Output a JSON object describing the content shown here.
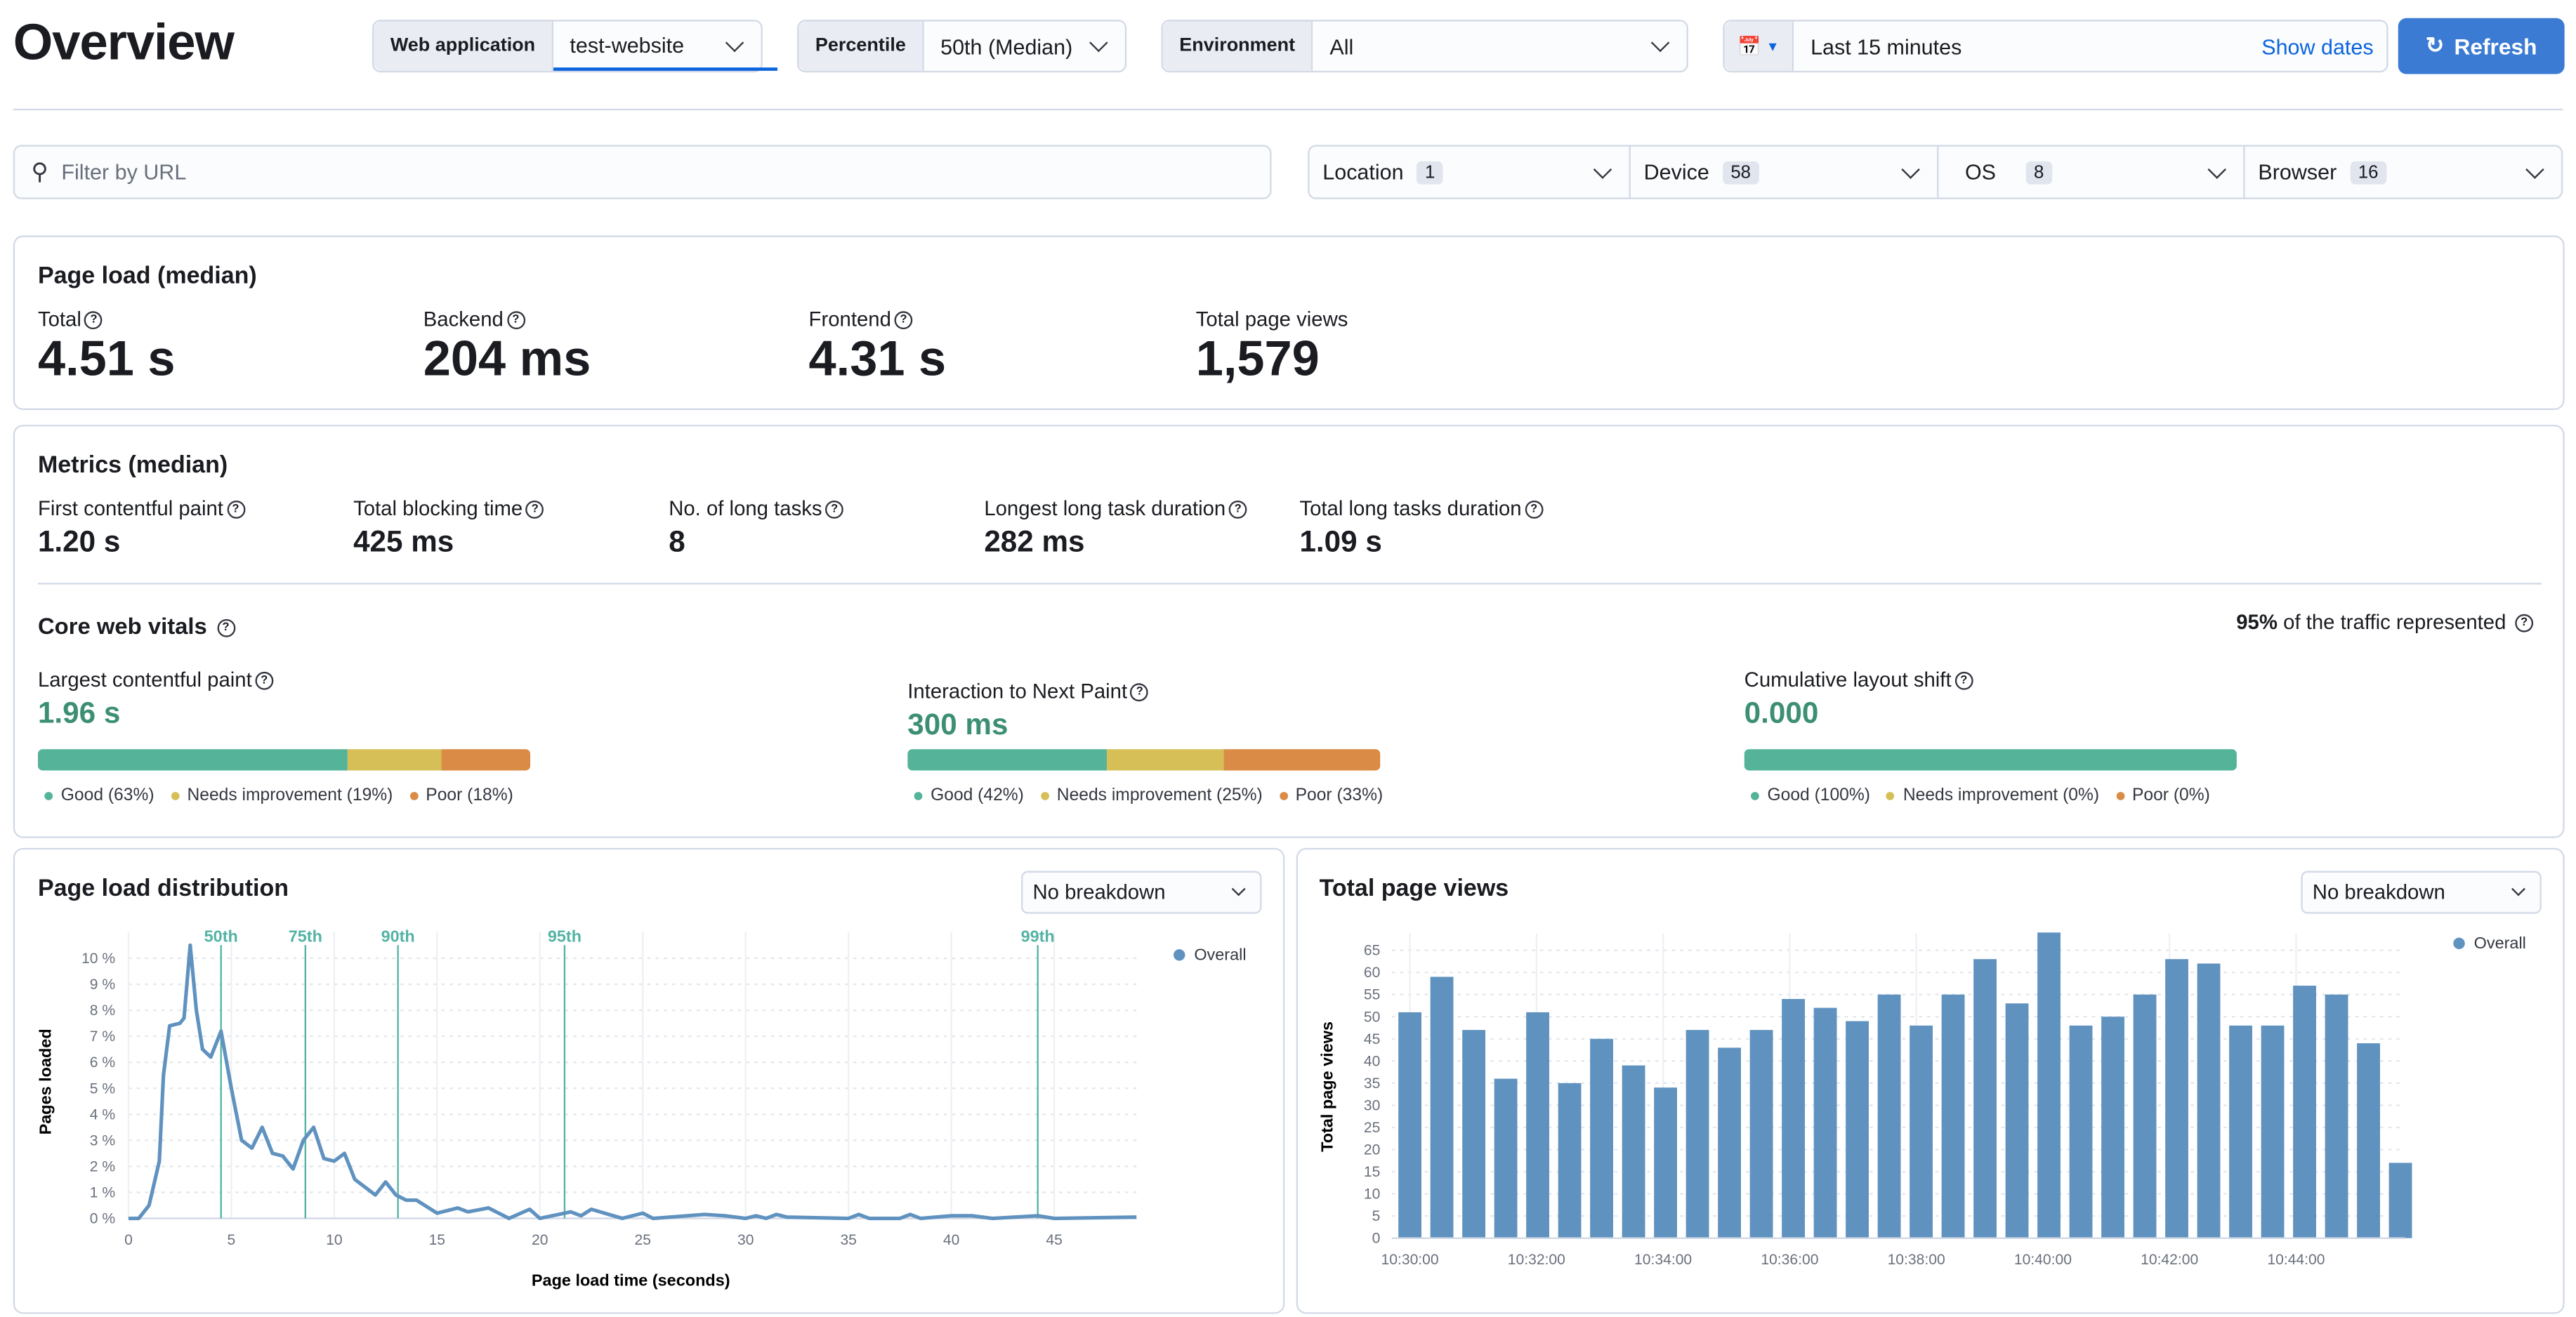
{
  "header": {
    "title": "Overview",
    "web_app_label": "Web application",
    "web_app_value": "test-website",
    "percentile_label": "Percentile",
    "percentile_value": "50th (Median)",
    "environment_label": "Environment",
    "environment_value": "All",
    "date_range": "Last 15 minutes",
    "show_dates": "Show dates",
    "refresh": "Refresh"
  },
  "filters": {
    "url_placeholder": "Filter by URL",
    "items": [
      {
        "label": "Location",
        "count": "1"
      },
      {
        "label": "Device",
        "count": "58"
      },
      {
        "label": "OS",
        "count": "8"
      },
      {
        "label": "Browser",
        "count": "16"
      }
    ]
  },
  "page_load": {
    "title": "Page load (median)",
    "stats": [
      {
        "label": "Total",
        "value": "4.51 s"
      },
      {
        "label": "Backend",
        "value": "204 ms"
      },
      {
        "label": "Frontend",
        "value": "4.31 s"
      },
      {
        "label": "Total page views",
        "value": "1,579"
      }
    ]
  },
  "metrics": {
    "title": "Metrics (median)",
    "stats": [
      {
        "label": "First contentful paint",
        "value": "1.20 s"
      },
      {
        "label": "Total blocking time",
        "value": "425 ms"
      },
      {
        "label": "No. of long tasks",
        "value": "8"
      },
      {
        "label": "Longest long task duration",
        "value": "282 ms"
      },
      {
        "label": "Total long tasks duration",
        "value": "1.09 s"
      }
    ]
  },
  "core_web_vitals": {
    "title": "Core web vitals",
    "traffic_pct": "95%",
    "traffic_text": "of the traffic represented",
    "colors": {
      "good": "#54b399",
      "needs": "#d6bf57",
      "poor": "#da8b45"
    },
    "vitals": [
      {
        "label": "Largest contentful paint",
        "value": "1.96 s",
        "good": 63,
        "needs": 19,
        "poor": 18,
        "legend": [
          "Good (63%)",
          "Needs improvement (19%)",
          "Poor (18%)"
        ]
      },
      {
        "label": "Interaction to Next Paint",
        "value": "300 ms",
        "good": 42,
        "needs": 25,
        "poor": 33,
        "legend": [
          "Good (42%)",
          "Needs improvement (25%)",
          "Poor (33%)"
        ]
      },
      {
        "label": "Cumulative layout shift",
        "value": "0.000",
        "good": 100,
        "needs": 0,
        "poor": 0,
        "legend": [
          "Good (100%)",
          "Needs improvement (0%)",
          "Poor (0%)"
        ]
      }
    ]
  },
  "chart_data": [
    {
      "type": "line",
      "title": "Page load distribution",
      "breakdown": "No breakdown",
      "xlabel": "Page load time (seconds)",
      "ylabel": "Pages loaded",
      "xlim": [
        0,
        49
      ],
      "ylim": [
        0,
        10.5
      ],
      "xticks": [
        0,
        5,
        10,
        15,
        20,
        25,
        30,
        35,
        40,
        45
      ],
      "yticks": [
        "0 %",
        "1 %",
        "2 %",
        "3 %",
        "4 %",
        "5 %",
        "6 %",
        "7 %",
        "8 %",
        "9 %",
        "10 %"
      ],
      "legend": "top-right",
      "grid": true,
      "series": [
        {
          "name": "Overall",
          "color": "#6092c0",
          "points": [
            [
              0,
              0
            ],
            [
              0.5,
              0
            ],
            [
              1,
              0.5
            ],
            [
              1.5,
              2.2
            ],
            [
              1.7,
              5.5
            ],
            [
              2,
              7.4
            ],
            [
              2.5,
              7.5
            ],
            [
              2.7,
              7.7
            ],
            [
              3,
              10.5
            ],
            [
              3.3,
              8
            ],
            [
              3.6,
              6.5
            ],
            [
              4,
              6.2
            ],
            [
              4.5,
              7.2
            ],
            [
              5,
              5
            ],
            [
              5.5,
              3
            ],
            [
              6,
              2.7
            ],
            [
              6.5,
              3.5
            ],
            [
              7,
              2.5
            ],
            [
              7.5,
              2.4
            ],
            [
              8,
              1.9
            ],
            [
              8.5,
              3
            ],
            [
              9,
              3.5
            ],
            [
              9.5,
              2.3
            ],
            [
              10,
              2.2
            ],
            [
              10.5,
              2.5
            ],
            [
              11,
              1.5
            ],
            [
              11.5,
              1.2
            ],
            [
              12,
              0.9
            ],
            [
              12.5,
              1.4
            ],
            [
              13,
              0.9
            ],
            [
              13.5,
              0.7
            ],
            [
              14,
              0.7
            ],
            [
              15,
              0.2
            ],
            [
              16,
              0.4
            ],
            [
              16.5,
              0.25
            ],
            [
              17.5,
              0.4
            ],
            [
              18.5,
              0
            ],
            [
              19.5,
              0.35
            ],
            [
              20,
              0
            ],
            [
              21.5,
              0.25
            ],
            [
              22,
              0.1
            ],
            [
              22.5,
              0.35
            ],
            [
              24,
              0
            ],
            [
              25,
              0.2
            ],
            [
              25.5,
              0
            ],
            [
              28,
              0.15
            ],
            [
              29,
              0.1
            ],
            [
              30,
              0
            ],
            [
              30.5,
              0.1
            ],
            [
              31,
              0
            ],
            [
              31.5,
              0.15
            ],
            [
              32,
              0.05
            ],
            [
              35,
              0
            ],
            [
              35.5,
              0.15
            ],
            [
              36,
              0
            ],
            [
              37.5,
              0
            ],
            [
              38,
              0.15
            ],
            [
              38.5,
              0
            ],
            [
              40,
              0.1
            ],
            [
              41,
              0.1
            ],
            [
              42,
              0
            ],
            [
              44.2,
              0.1
            ],
            [
              45,
              0
            ],
            [
              49,
              0.05
            ]
          ]
        }
      ],
      "percentiles": [
        {
          "label": "50th",
          "x": 4.5
        },
        {
          "label": "75th",
          "x": 8.6
        },
        {
          "label": "90th",
          "x": 13.1
        },
        {
          "label": "95th",
          "x": 21.2
        },
        {
          "label": "99th",
          "x": 44.2
        }
      ],
      "percentile_color": "#54b3a4"
    },
    {
      "type": "bar",
      "title": "Total page views",
      "breakdown": "No breakdown",
      "ylabel": "Total page views",
      "xlabel": "",
      "ylim": [
        0,
        68
      ],
      "yticks": [
        0,
        5,
        10,
        15,
        20,
        25,
        30,
        35,
        40,
        45,
        50,
        55,
        60,
        65
      ],
      "xticks": [
        "10:30:00",
        "10:32:00",
        "10:34:00",
        "10:36:00",
        "10:38:00",
        "10:40:00",
        "10:42:00",
        "10:44:00"
      ],
      "legend": "top-right",
      "grid": true,
      "series": [
        {
          "name": "Overall",
          "color": "#6092c0",
          "values": [
            51,
            59,
            47,
            36,
            51,
            35,
            45,
            39,
            34,
            47,
            43,
            47,
            54,
            52,
            49,
            55,
            48,
            55,
            63,
            53,
            69,
            48,
            50,
            55,
            63,
            62,
            48,
            48,
            57,
            55,
            44,
            17
          ]
        }
      ]
    }
  ]
}
